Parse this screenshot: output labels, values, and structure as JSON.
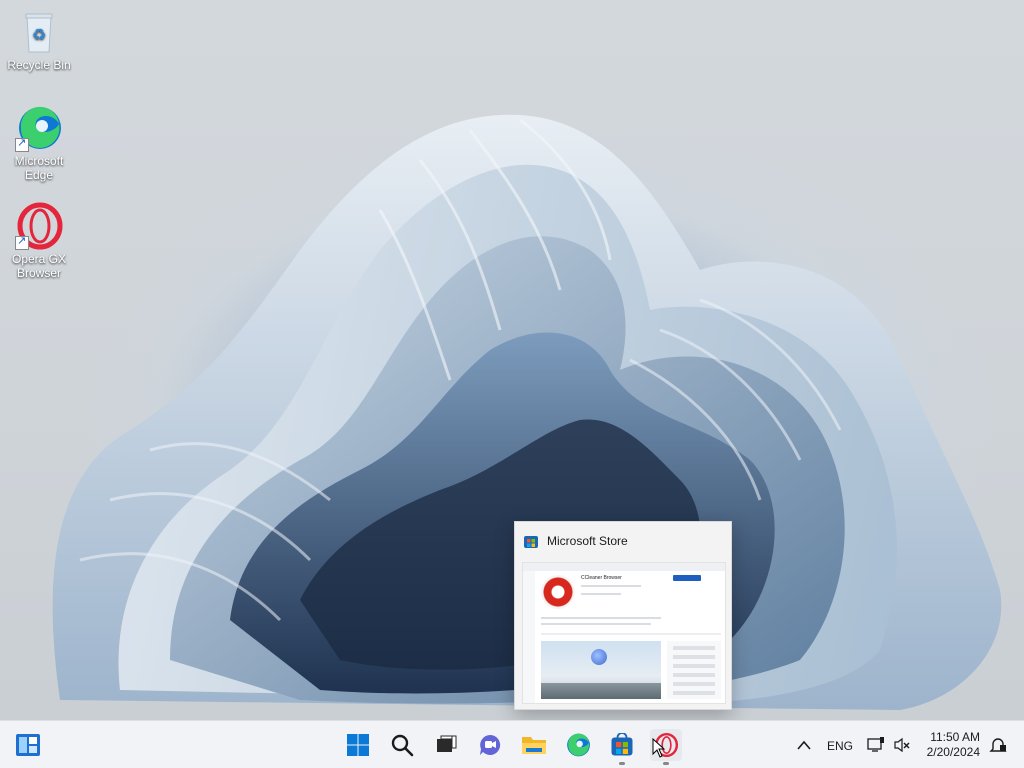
{
  "desktop": {
    "icons": [
      {
        "label": "Recycle Bin",
        "icon": "recycle-bin-icon"
      },
      {
        "label": "Microsoft Edge",
        "icon": "edge-icon"
      },
      {
        "label": "Opera GX Browser",
        "icon": "opera-gx-icon"
      }
    ]
  },
  "preview": {
    "title": "Microsoft Store",
    "icon": "microsoft-store-icon",
    "content_app_name": "CCleaner Browser"
  },
  "taskbar": {
    "widgets_icon": "widgets-icon",
    "apps": [
      {
        "name": "Start",
        "icon": "windows-start-icon"
      },
      {
        "name": "Search",
        "icon": "search-icon"
      },
      {
        "name": "Task View",
        "icon": "task-view-icon"
      },
      {
        "name": "Chat",
        "icon": "chat-icon"
      },
      {
        "name": "File Explorer",
        "icon": "file-explorer-icon"
      },
      {
        "name": "Microsoft Edge",
        "icon": "edge-icon"
      },
      {
        "name": "Microsoft Store",
        "icon": "microsoft-store-icon",
        "running": true
      },
      {
        "name": "Opera GX Browser",
        "icon": "opera-gx-icon",
        "running": true
      }
    ],
    "tray": {
      "chevron_icon": "chevron-up-icon",
      "language": "ENG",
      "network_icon": "network-icon",
      "volume_icon": "volume-muted-icon",
      "time": "11:50 AM",
      "date": "2/20/2024",
      "notification_icon": "notification-icon"
    }
  },
  "colors": {
    "taskbar_bg": "#f1f3f6",
    "opera_red": "#e3263c",
    "windows_blue": "#0a7ad6"
  }
}
